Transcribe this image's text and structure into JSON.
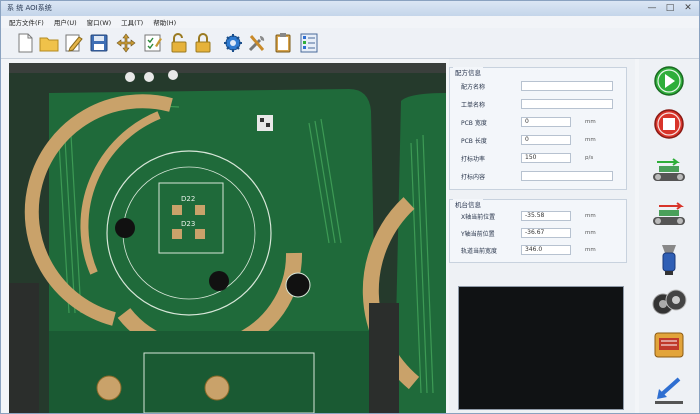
{
  "window": {
    "title": "系 统 AOI系统",
    "controls": [
      "—",
      "□",
      "✕"
    ]
  },
  "menu": {
    "items": [
      "配方文件(F)",
      "用户(U)",
      "窗口(W)",
      "工具(T)",
      "帮助(H)"
    ]
  },
  "toolbar": {
    "icons": [
      "new-file-icon",
      "open-folder-icon",
      "edit-icon",
      "save-icon",
      "move-icon",
      "checklist-icon",
      "unlock-icon",
      "lock-icon",
      "settings-icon",
      "tools-icon",
      "clipboard-icon",
      "list-icon"
    ]
  },
  "recipe": {
    "title": "配方信息",
    "rows": [
      {
        "label": "配方名称",
        "value": "",
        "unit": ""
      },
      {
        "label": "工单名称",
        "value": "",
        "unit": ""
      },
      {
        "label": "PCB 宽度",
        "value": "0",
        "unit": "mm"
      },
      {
        "label": "PCB 长度",
        "value": "0",
        "unit": "mm"
      },
      {
        "label": "打标功率",
        "value": "150",
        "unit": "p/s"
      },
      {
        "label": "打标内容",
        "value": "",
        "unit": ""
      }
    ]
  },
  "machine": {
    "title": "机台信息",
    "rows": [
      {
        "label": "X轴当前位置",
        "value": "-35.58",
        "unit": "mm"
      },
      {
        "label": "Y轴当前位置",
        "value": "-36.67",
        "unit": "mm"
      },
      {
        "label": "轨道当前宽度",
        "value": "346.0",
        "unit": "mm"
      }
    ]
  },
  "camera": {
    "labels": [
      "D22",
      "D23"
    ]
  },
  "side_buttons": [
    "start-button",
    "stop-button",
    "conveyor-in-button",
    "conveyor-out-button",
    "vacuum-button",
    "reel-button",
    "feeder-button",
    "return-button"
  ],
  "colors": {
    "pcb_green": "#1f6a3a",
    "trace_green": "#3d9a55",
    "copper": "#c9a26a",
    "start_green": "#2fae3a",
    "stop_red": "#d8342a"
  }
}
